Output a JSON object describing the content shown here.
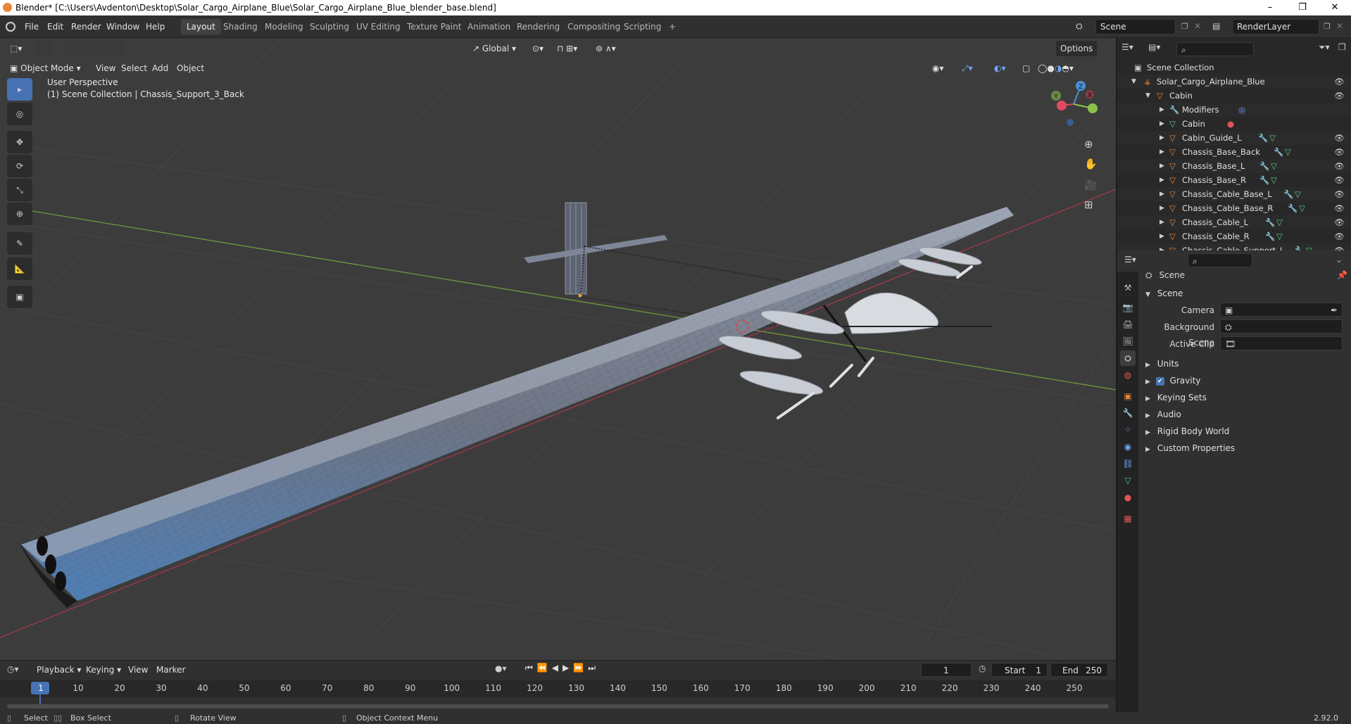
{
  "title_bar": {
    "title": "Blender* [C:\\Users\\Avdenton\\Desktop\\Solar_Cargo_Airplane_Blue\\Solar_Cargo_Airplane_Blue_blender_base.blend]",
    "minimize": "–",
    "maximize": "❐",
    "close": "✕"
  },
  "top_menu": {
    "items": [
      "File",
      "Edit",
      "Render",
      "Window",
      "Help"
    ],
    "workspaces": [
      "Layout",
      "Shading",
      "Modeling",
      "Sculpting",
      "UV Editing",
      "Texture Paint",
      "Animation",
      "Rendering",
      "Compositing",
      "Scripting"
    ],
    "add_workspace": "+",
    "scene": "Scene",
    "render_layer": "RenderLayer"
  },
  "viewport_header": {
    "mode": "Object Mode",
    "menus": [
      "View",
      "Select",
      "Add",
      "Object"
    ],
    "transform_orientation": "Global",
    "options": "Options"
  },
  "viewport": {
    "perspective": "User Perspective",
    "collection_info": "(1) Scene Collection | Chassis_Support_3_Back",
    "gizmo_axes": [
      "X",
      "Y",
      "Z"
    ]
  },
  "outliner": {
    "root": "Scene Collection",
    "items": [
      {
        "label": "Solar_Cargo_Airplane_Blue",
        "indent": 1
      },
      {
        "label": "Cabin",
        "indent": 2
      },
      {
        "label": "Modifiers",
        "indent": 3
      },
      {
        "label": "Cabin",
        "indent": 3
      },
      {
        "label": "Cabin_Guide_L",
        "indent": 3
      },
      {
        "label": "Chassis_Base_Back",
        "indent": 3
      },
      {
        "label": "Chassis_Base_L",
        "indent": 3
      },
      {
        "label": "Chassis_Base_R",
        "indent": 3
      },
      {
        "label": "Chassis_Cable_Base_L",
        "indent": 3
      },
      {
        "label": "Chassis_Cable_Base_R",
        "indent": 3
      },
      {
        "label": "Chassis_Cable_L",
        "indent": 3
      },
      {
        "label": "Chassis_Cable_R",
        "indent": 3
      },
      {
        "label": "Chassis_Cable_Support_L",
        "indent": 3
      }
    ]
  },
  "properties": {
    "context": "Scene",
    "section": "Scene",
    "fields": [
      {
        "label": "Camera",
        "value": ""
      },
      {
        "label": "Background Scene",
        "value": ""
      },
      {
        "label": "Active Clip",
        "value": ""
      }
    ],
    "panels": [
      {
        "label": "Units",
        "checkbox": false
      },
      {
        "label": "Gravity",
        "checkbox": true
      },
      {
        "label": "Keying Sets",
        "checkbox": false
      },
      {
        "label": "Audio",
        "checkbox": false
      },
      {
        "label": "Rigid Body World",
        "checkbox": false
      },
      {
        "label": "Custom Properties",
        "checkbox": false
      }
    ]
  },
  "timeline": {
    "menus": [
      "Playback",
      "Keying",
      "View",
      "Marker"
    ],
    "current_frame": "1",
    "start_label": "Start",
    "start": "1",
    "end_label": "End",
    "end": "250",
    "ticks": [
      "1",
      "10",
      "20",
      "30",
      "40",
      "50",
      "60",
      "70",
      "80",
      "90",
      "100",
      "110",
      "120",
      "130",
      "140",
      "150",
      "160",
      "170",
      "180",
      "190",
      "200",
      "210",
      "220",
      "230",
      "240",
      "250"
    ]
  },
  "status_bar": {
    "select": "Select",
    "box_select": "Box Select",
    "rotate_view": "Rotate View",
    "context_menu": "Object Context Menu",
    "version": "2.92.0"
  },
  "colors": {
    "accent": "#4772b3",
    "x_axis": "#e04a5f",
    "y_axis": "#8bc34a",
    "z_axis": "#4a90d9",
    "object_orange": "#e8873b",
    "mesh_green": "#5fc48d"
  }
}
